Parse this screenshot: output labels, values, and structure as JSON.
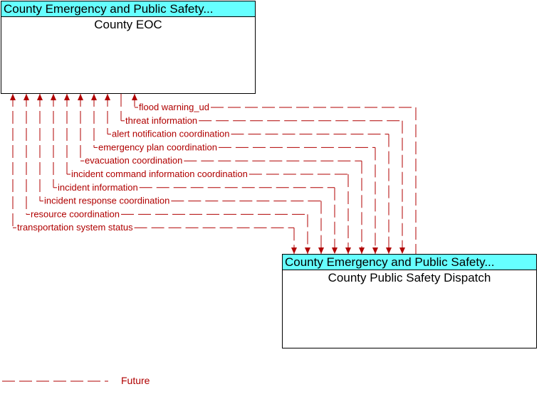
{
  "nodes": {
    "eoc": {
      "stakeholder": "County Emergency and Public Safety...",
      "name": "County EOC"
    },
    "dispatch": {
      "stakeholder": "County Emergency and Public Safety...",
      "name": "County Public Safety Dispatch"
    }
  },
  "colors": {
    "flow": "#b00000",
    "header": "#66ffff"
  },
  "flows": [
    {
      "label": "flood warning_ud",
      "direction": "to-eoc",
      "status": "future"
    },
    {
      "label": "threat information",
      "direction": "to-dispatch",
      "status": "future"
    },
    {
      "label": "alert notification coordination",
      "direction": "both",
      "status": "future"
    },
    {
      "label": "emergency plan coordination",
      "direction": "both",
      "status": "future"
    },
    {
      "label": "evacuation coordination",
      "direction": "both",
      "status": "future"
    },
    {
      "label": "incident command information coordination",
      "direction": "both",
      "status": "future"
    },
    {
      "label": "incident information",
      "direction": "both",
      "status": "future"
    },
    {
      "label": "incident response coordination",
      "direction": "both",
      "status": "future"
    },
    {
      "label": "resource coordination",
      "direction": "both",
      "status": "future"
    },
    {
      "label": "transportation system status",
      "direction": "both",
      "status": "future"
    }
  ],
  "legend": {
    "future_label": "Future"
  }
}
